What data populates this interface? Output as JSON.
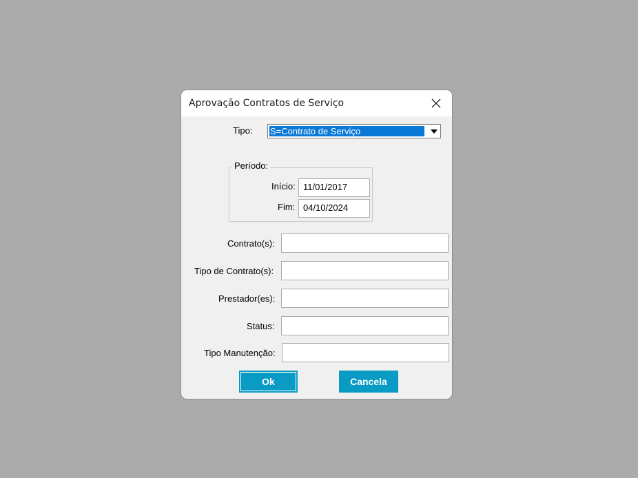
{
  "dialog": {
    "title": "Aprovação Contratos de Serviço",
    "close_icon": "close-icon"
  },
  "tipo": {
    "label": "Tipo:",
    "selected": "S=Contrato de Serviço"
  },
  "periodo": {
    "title": "Período:",
    "inicio_label": "Início:",
    "inicio_value": "11/01/2017",
    "fim_label": "Fim:",
    "fim_value": "04/10/2024"
  },
  "filters": {
    "contratos_label": "Contrato(s):",
    "contratos_value": "",
    "tipo_contrato_label": "Tipo de Contrato(s):",
    "tipo_contrato_value": "",
    "prestador_label": "Prestador(es):",
    "prestador_value": "",
    "status_label": "Status:",
    "status_value": "",
    "tipo_manutencao_label": "Tipo Manutenção:",
    "tipo_manutencao_value": ""
  },
  "buttons": {
    "ok_label": "Ok",
    "cancel_label": "Cancela"
  },
  "colors": {
    "accent": "#0a9bc5",
    "selection": "#0a78d7",
    "background": "#ababab"
  }
}
